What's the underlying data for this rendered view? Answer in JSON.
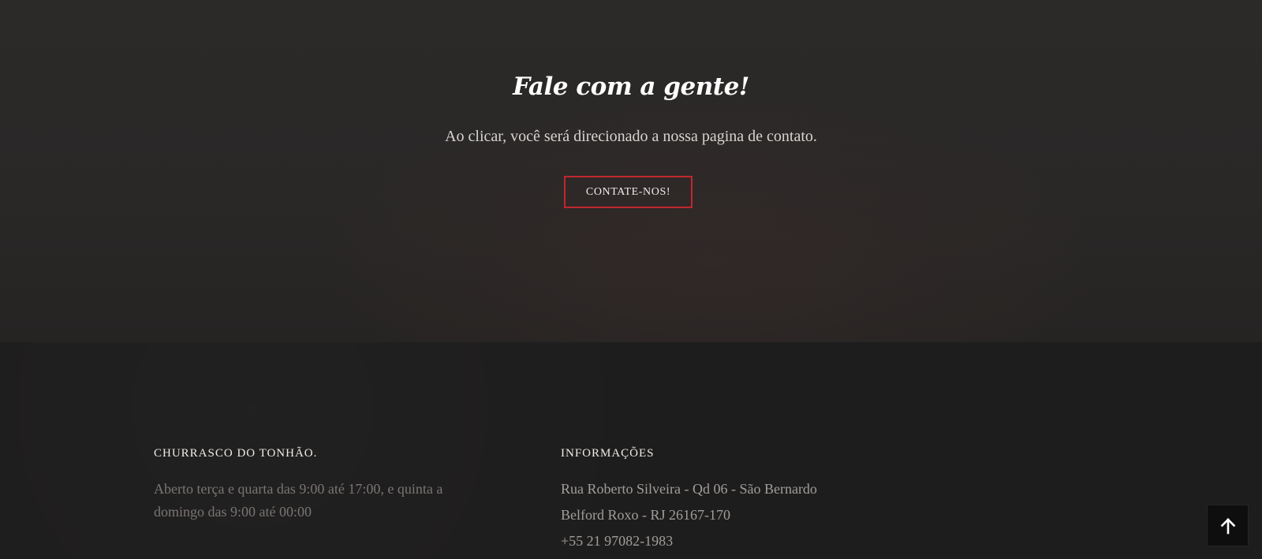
{
  "contact": {
    "title": "Fale com a gente!",
    "subtitle": "Ao clicar, você será direcionado a nossa pagina de contato.",
    "button_label": "CONTATE-NOS!",
    "accent_color": "#c0272d"
  },
  "footer": {
    "about": {
      "title": "CHURRASCO DO TONHÃO.",
      "text": "Aberto terça e quarta das 9:00 até 17:00, e quinta a domingo das 9:00 até 00:00"
    },
    "info": {
      "title": "INFORMAÇÕES",
      "lines": [
        "Rua Roberto Silveira - Qd 06 - São Bernardo",
        "Belford Roxo - RJ 26167-170",
        "+55 21 97082-1983"
      ]
    }
  },
  "back_to_top": {
    "icon": "arrow-up-icon"
  }
}
